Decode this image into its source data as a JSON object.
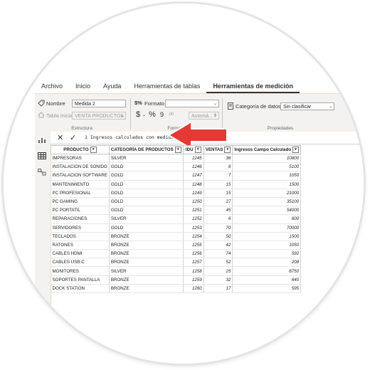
{
  "ribbon": {
    "tabs": [
      {
        "label": "Archivo",
        "active": false
      },
      {
        "label": "Inicio",
        "active": false
      },
      {
        "label": "Ayuda",
        "active": false
      },
      {
        "label": "Herramientas de tablas",
        "active": false
      },
      {
        "label": "Herramientas de medición",
        "active": true
      }
    ],
    "structure": {
      "name_label": "Nombre",
      "name_value": "Medida 2",
      "home_table_label": "Tabla inicial",
      "home_table_value": "VENTA PRODUCTOS",
      "caption": "Estructura"
    },
    "format": {
      "format_label": "Formato",
      "format_value": "",
      "currency_symbol": "$",
      "percent_symbol": "%",
      "comma_symbol": "9",
      "decimals_symbol": ".00",
      "auto_value": "Automá...",
      "caption": "Formato"
    },
    "properties": {
      "data_category_label": "Categoría de datos",
      "data_category_value": "Sin clasificar",
      "caption": "Propiedades"
    }
  },
  "formula_bar": {
    "cancel_icon": "close-icon",
    "commit_icon": "check-icon",
    "expression": "1 Ingresos calculados con medida ="
  },
  "table": {
    "columns": [
      "PRODUCTO",
      "CATEGORÍA DE PRODUCTOS",
      "IDU",
      "VENTAS",
      "Ingresos Campo Calculado"
    ],
    "rows": [
      [
        "IMPRESORAS",
        "SILVER",
        "1245",
        "36",
        "10800"
      ],
      [
        "INSTALACION DE SONIDO",
        "GOLD",
        "1246",
        "6",
        "5100"
      ],
      [
        "INSTALACION SOFTWARE",
        "GOLD",
        "1247",
        "7",
        "1050"
      ],
      [
        "MANTENIMIENTO",
        "GOLD",
        "1248",
        "15",
        "1500"
      ],
      [
        "PC PROFESIONAL",
        "GOLD",
        "1249",
        "15",
        "21000"
      ],
      [
        "PC GAMING",
        "GOLD",
        "1250",
        "27",
        "35100"
      ],
      [
        "PC PORTATIL",
        "GOLD",
        "1251",
        "45",
        "54000"
      ],
      [
        "REPARACIONES",
        "SILVER",
        "1252",
        "6",
        "600"
      ],
      [
        "SERVIDORES",
        "GOLD",
        "1253",
        "70",
        "70000"
      ],
      [
        "TECLADOS",
        "BRONZE",
        "1254",
        "50",
        "1500"
      ],
      [
        "RATONES",
        "BRONZE",
        "1255",
        "42",
        "1050"
      ],
      [
        "CABLES HDMI",
        "BRONZE",
        "1256",
        "74",
        "592"
      ],
      [
        "CABLES USB-C",
        "BRONZE",
        "1257",
        "52",
        "208"
      ],
      [
        "MONITORES",
        "SILVER",
        "1258",
        "25",
        "8750"
      ],
      [
        "SOPORTES PANTALLA",
        "BRONZE",
        "1259",
        "32",
        "640"
      ],
      [
        "DOCK STATION",
        "BRONZE",
        "1260",
        "17",
        "595"
      ]
    ]
  },
  "colors": {
    "arrow": "#e53935",
    "ribbon_bg": "#f3f2f1"
  }
}
